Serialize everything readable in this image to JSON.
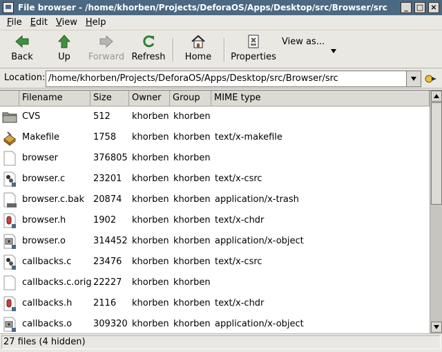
{
  "window": {
    "title": "File browser - /home/khorben/Projects/DeforaOS/Apps/Desktop/src/Browser/src",
    "minimize_glyph": "_",
    "maximize_glyph": "□",
    "close_glyph": "×"
  },
  "menubar": {
    "items": [
      {
        "label": "File",
        "accel": "F",
        "rest": "ile"
      },
      {
        "label": "Edit",
        "accel": "E",
        "rest": "dit"
      },
      {
        "label": "View",
        "accel": "V",
        "rest": "iew"
      },
      {
        "label": "Help",
        "accel": "H",
        "rest": "elp"
      }
    ]
  },
  "toolbar": {
    "back": "Back",
    "up": "Up",
    "forward": "Forward",
    "refresh": "Refresh",
    "home": "Home",
    "properties": "Properties",
    "view_as": "View as..."
  },
  "location": {
    "label": "Location:",
    "value": "/home/khorben/Projects/DeforaOS/Apps/Desktop/src/Browser/src"
  },
  "columns": {
    "filename": "Filename",
    "size": "Size",
    "owner": "Owner",
    "group": "Group",
    "mime": "MIME type"
  },
  "files": [
    {
      "name": "CVS",
      "size": "512",
      "owner": "khorben",
      "group": "khorben",
      "mime": "",
      "icon": "folder-icon"
    },
    {
      "name": "Makefile",
      "size": "1758",
      "owner": "khorben",
      "group": "khorben",
      "mime": "text/x-makefile",
      "icon": "makefile-icon"
    },
    {
      "name": "browser",
      "size": "376805",
      "owner": "khorben",
      "group": "khorben",
      "mime": "",
      "icon": "blank-file-icon"
    },
    {
      "name": "browser.c",
      "size": "23201",
      "owner": "khorben",
      "group": "khorben",
      "mime": "text/x-csrc",
      "icon": "c-source-icon"
    },
    {
      "name": "browser.c.bak",
      "size": "20874",
      "owner": "khorben",
      "group": "khorben",
      "mime": "application/x-trash",
      "icon": "backup-file-icon"
    },
    {
      "name": "browser.h",
      "size": "1902",
      "owner": "khorben",
      "group": "khorben",
      "mime": "text/x-chdr",
      "icon": "c-header-icon"
    },
    {
      "name": "browser.o",
      "size": "314452",
      "owner": "khorben",
      "group": "khorben",
      "mime": "application/x-object",
      "icon": "object-file-icon"
    },
    {
      "name": "callbacks.c",
      "size": "23476",
      "owner": "khorben",
      "group": "khorben",
      "mime": "text/x-csrc",
      "icon": "c-source-icon"
    },
    {
      "name": "callbacks.c.orig",
      "size": "22227",
      "owner": "khorben",
      "group": "khorben",
      "mime": "",
      "icon": "blank-file-icon"
    },
    {
      "name": "callbacks.h",
      "size": "2116",
      "owner": "khorben",
      "group": "khorben",
      "mime": "text/x-chdr",
      "icon": "c-header-icon"
    },
    {
      "name": "callbacks.o",
      "size": "309320",
      "owner": "khorben",
      "group": "khorben",
      "mime": "application/x-object",
      "icon": "object-file-icon"
    }
  ],
  "status": {
    "text": "27 files (4 hidden)"
  },
  "colors": {
    "titlebar": "#4b6983",
    "background": "#eae8e3",
    "list_background": "#ffffff",
    "header_background": "#dcdad5"
  }
}
